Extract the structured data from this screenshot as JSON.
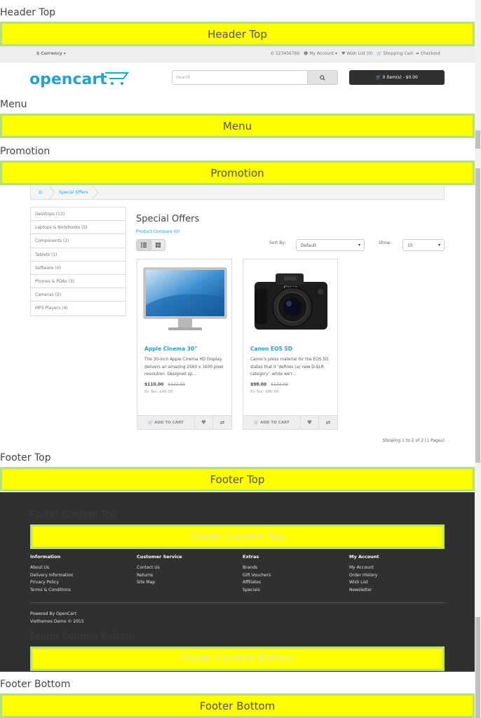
{
  "positions": {
    "header_top": "Header Top",
    "menu": "Menu",
    "promotion": "Promotion",
    "footer_top": "Footer Top",
    "footer_content_top": "Footer Content Top",
    "footer_content_bottom": "Footer Content Bottom",
    "footer_bottom": "Footer Bottom"
  },
  "topbar": {
    "currency": "$ Currency",
    "phone": "123456789",
    "my_account": "My Account",
    "wish_list": "Wish List (0)",
    "shopping_cart": "Shopping Cart",
    "checkout": "Checkout"
  },
  "header": {
    "logo": "opencart",
    "search_placeholder": "Search",
    "cart": "0 item(s) - $0.00"
  },
  "breadcrumb": {
    "current": "Special Offers"
  },
  "categories": [
    "Desktops (13)",
    "Laptops & Notebooks (5)",
    "Components (2)",
    "Tablets (1)",
    "Software (0)",
    "Phones & PDAs (3)",
    "Cameras (2)",
    "MP3 Players (4)"
  ],
  "main": {
    "title": "Special Offers",
    "compare": "Product Compare (0)",
    "sort_label": "Sort By:",
    "sort_value": "Default",
    "show_label": "Show:",
    "show_value": "15",
    "showing": "Showing 1 to 2 of 2 (1 Pages)"
  },
  "products": [
    {
      "name": "Apple Cinema 30\"",
      "desc": "The 30-inch Apple Cinema HD Display delivers an amazing 2560 x 1600 pixel resolution. Designed sp...",
      "price": "$110.00",
      "old_price": "$122.00",
      "tax": "Ex Tax: $90.00",
      "add_to_cart": "ADD TO CART"
    },
    {
      "name": "Canon EOS 5D",
      "desc": "Canon's press material for the EOS 5D states that it 'defines (a) new D-SLR category', while we'r...",
      "price": "$98.00",
      "old_price": "$122.00",
      "tax": "Ex Tax: $80.00",
      "add_to_cart": "ADD TO CART"
    }
  ],
  "footer": {
    "information": {
      "title": "Information",
      "links": [
        "About Us",
        "Delivery Information",
        "Privacy Policy",
        "Terms & Conditions"
      ]
    },
    "customer_service": {
      "title": "Customer Service",
      "links": [
        "Contact Us",
        "Returns",
        "Site Map"
      ]
    },
    "extras": {
      "title": "Extras",
      "links": [
        "Brands",
        "Gift Vouchers",
        "Affiliates",
        "Specials"
      ]
    },
    "my_account": {
      "title": "My Account",
      "links": [
        "My Account",
        "Order History",
        "Wish List",
        "Newsletter"
      ]
    },
    "powered_prefix": "Powered By ",
    "powered_link": "OpenCart",
    "demo": "Viethemes Demo © 2015"
  },
  "colors": {
    "accent": "#23a1d1",
    "highlight": "#ffff00",
    "footer_bg": "#303030"
  }
}
